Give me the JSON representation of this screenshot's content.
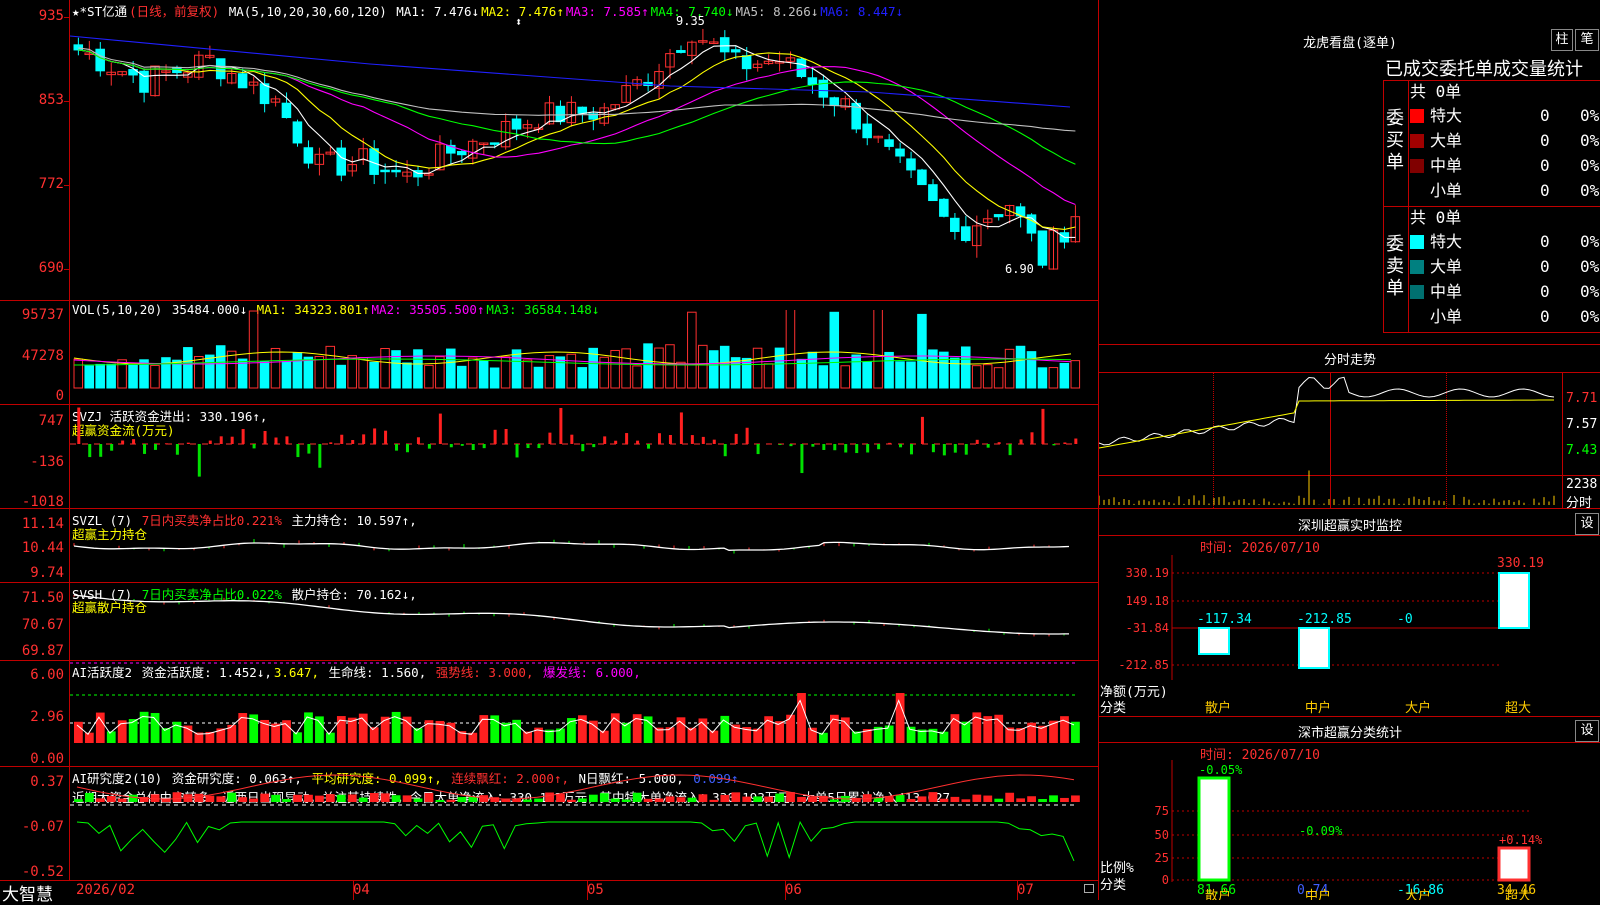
{
  "main": {
    "legend_title": "★*ST亿通",
    "period": "(日线，前复权)",
    "ma_label": "MA(5,10,20,30,60,120)",
    "ma": [
      {
        "label": "MA1:",
        "value": "7.476↓",
        "color": "#ffffff"
      },
      {
        "label": "MA2:",
        "value": "7.476↑",
        "color": "#ffff00"
      },
      {
        "label": "MA3:",
        "value": "7.585↑",
        "color": "#ff00ff"
      },
      {
        "label": "MA4:",
        "value": "7.740↓",
        "color": "#00ff00"
      },
      {
        "label": "MA5:",
        "value": "8.266↓",
        "color": "#c0c0c0"
      },
      {
        "label": "MA6:",
        "value": "8.447↓",
        "color": "#2020ff"
      }
    ],
    "y_labels": [
      "935",
      "853",
      "772",
      "690"
    ],
    "high_label": "9.35",
    "low_label": "6.90"
  },
  "vol": {
    "legend": "VOL(5,10,20)",
    "value": "35484.000↓",
    "ma": [
      {
        "label": "MA1:",
        "value": "34323.801↑",
        "color": "#ffff00"
      },
      {
        "label": "MA2:",
        "value": "35505.500↑",
        "color": "#ff00ff"
      },
      {
        "label": "MA3:",
        "value": "36584.148↓",
        "color": "#00ff00"
      }
    ],
    "y_labels": [
      "95737",
      "47278",
      "0"
    ]
  },
  "svzj": {
    "legend": "SVZJ  活跃资金进出: 330.196↑,",
    "sub": "超赢资金流(万元)",
    "y_labels": [
      "747",
      "-136",
      "-1018"
    ]
  },
  "svzl": {
    "legend_a": "SVZL (7)",
    "legend_b": "7日内买卖净占比0.221%",
    "legend_c": "主力持仓: 10.597↑,",
    "sub": "超赢主力持仓",
    "y_labels": [
      "11.14",
      "10.44",
      "9.74"
    ]
  },
  "svsh": {
    "legend_a": "SVSH (7)",
    "legend_b": "7日内买卖净占比0.022%",
    "legend_c": "散户持仓: 70.162↓,",
    "sub": "超赢散户持仓",
    "y_labels": [
      "71.50",
      "70.67",
      "69.87"
    ]
  },
  "ai1": {
    "a": "AI活跃度2",
    "b": "资金活跃度: 1.452↓,",
    "c": "3.647,",
    "d": "生命线: 1.560,",
    "e": "强势线: 3.000,",
    "f": "爆发线: 6.000,",
    "y_labels": [
      "6.00",
      "2.96",
      "0.00"
    ]
  },
  "ai2": {
    "a": "AI研究度2(10)",
    "b": "资金研究度: 0.063↑,",
    "c": "平均研究度: 0.099↑,",
    "d": "连续飘红: 2.000↑,",
    "e": "N日飘红: 5.000,",
    "f": "0.099↑",
    "comment": "近期大资金总体由空转多，近两日出现异动，关注其持续性，今日大单净流入：330.193万元，其中特大单净流入：330.193万元，大单5日累计净入413.027",
    "y_labels": [
      "0.37",
      "-0.07",
      "-0.52"
    ]
  },
  "xaxis": {
    "brand": "大智慧",
    "labels": [
      "2026/02",
      "04",
      "05",
      "06",
      "07"
    ]
  },
  "right": {
    "title": "龙虎看盘(逐单)",
    "btn_zhu": "柱",
    "btn_bi": "笔",
    "subtitle": "已成交委托单成交量统计",
    "buy_label": "委买单",
    "sell_label": "委卖单",
    "buy_total": "共 0单",
    "sell_total": "共 0单",
    "buy_rows": [
      {
        "name": "特大",
        "vol": "0",
        "pct": "0%",
        "color": "#ff0000"
      },
      {
        "name": "大单",
        "vol": "0",
        "pct": "0%",
        "color": "#a00000"
      },
      {
        "name": "中单",
        "vol": "0",
        "pct": "0%",
        "color": "#800000"
      },
      {
        "name": "小单",
        "vol": "0",
        "pct": "0%",
        "color": ""
      }
    ],
    "sell_rows": [
      {
        "name": "特大",
        "vol": "0",
        "pct": "0%",
        "color": "#00ffff"
      },
      {
        "name": "大单",
        "vol": "0",
        "pct": "0%",
        "color": "#008080"
      },
      {
        "name": "中单",
        "vol": "0",
        "pct": "0%",
        "color": "#007070"
      },
      {
        "name": "小单",
        "vol": "0",
        "pct": "0%",
        "color": ""
      }
    ],
    "intraday_title": "分时走势",
    "intraday_y": [
      "7.71",
      "7.57",
      "7.43"
    ],
    "intraday_vol": "2238",
    "intraday_vol_unit": "分时",
    "sz_title": "深圳超赢实时监控",
    "sz_set": "设",
    "sz_time": "时间: 2026/07/10",
    "sz_y": [
      "330.19",
      "149.18",
      "-31.84",
      "-212.85"
    ],
    "sz_vals": [
      "-117.34",
      "-212.85",
      "-0",
      "330.19"
    ],
    "sz_unit": "净额(万元)",
    "sz_cat": "分类",
    "cats": [
      "散户",
      "中户",
      "大户",
      "超大"
    ],
    "sc_title": "深市超赢分类统计",
    "sc_set": "设",
    "sc_time": "时间: 2026/07/10",
    "sc_y": [
      "75",
      "50",
      "25",
      "0"
    ],
    "sc_top": [
      "-0.05%",
      "-0.09%",
      "+0.14%"
    ],
    "sc_vals": [
      "81.66",
      "0.74",
      "-16.86",
      "34.46"
    ],
    "sc_unit": "比例%",
    "sc_cat": "分类"
  }
}
